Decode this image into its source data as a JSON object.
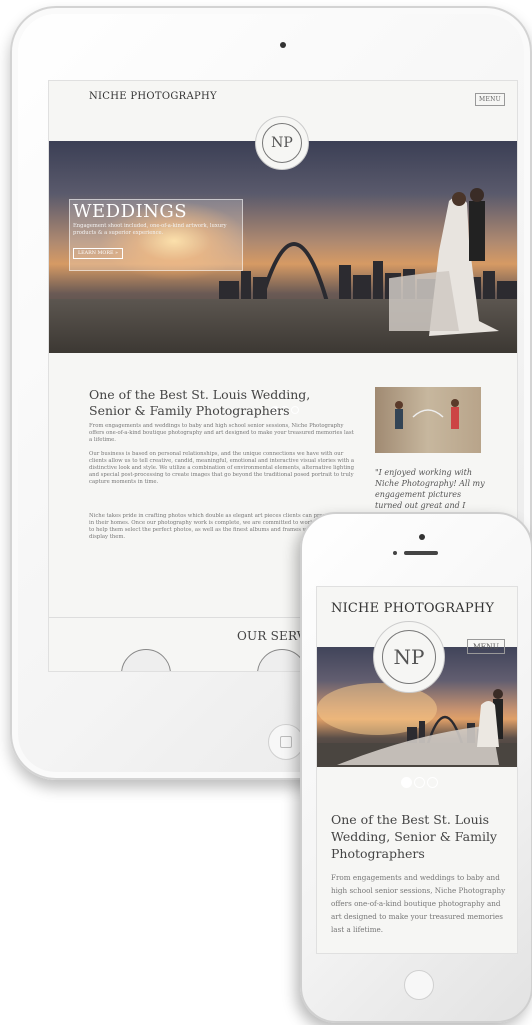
{
  "tablet": {
    "brand": "NICHE PHOTOGRAPHY",
    "menu_label": "MENU",
    "logo_text": "NP",
    "hero": {
      "title": "WEDDINGS",
      "subtitle": "Engagement shoot included, one-of-a-kind artwork, luxury products & a superior experience.",
      "button_label": "LEARN MORE »",
      "slides": 3,
      "active_slide": 1
    },
    "heading": "One of the Best St. Louis Wedding, Senior & Family Photographers",
    "paragraphs": [
      "From engagements and weddings to baby and high school senior sessions, Niche Photography offers one-of-a-kind boutique photography and art designed to make your treasured memories last a lifetime.",
      "Our business is based on personal relationships, and the unique connections we have with our clients allow us to tell creative, candid, meaningful, emotional and interactive visual stories with a distinctive look and style. We utilize a combination of environmental elements, alternative lighting and special post-processing to create images that go beyond the traditional posed portrait to truly capture moments in time.",
      "Niche takes pride in crafting photos which double as elegant art pieces clients can proudly display in their homes. Once our photography work is complete, we are committed to working with clients to help them select the perfect photos, as well as the finest albums and frames with which to display them."
    ],
    "testimonial": "\"I enjoyed working with Niche Photography! All my engagement pictures turned out great and I",
    "services_heading": "OUR SERV"
  },
  "phone": {
    "brand": "NICHE PHOTOGRAPHY",
    "menu_label": "MENU",
    "logo_text": "NP",
    "slides": 3,
    "active_slide": 1,
    "heading": "One of the Best St. Louis Wedding, Senior & Family Photographers",
    "paragraph": "From engagements and weddings to baby and high school senior sessions, Niche Photography offers one-of-a-kind boutique photography and art designed to make your treasured memories last a lifetime."
  },
  "colors": {
    "page_bg": "#f6f6f4",
    "text_dark": "#444444",
    "text_body": "#777777",
    "device_frame": "#f3f3f3"
  }
}
